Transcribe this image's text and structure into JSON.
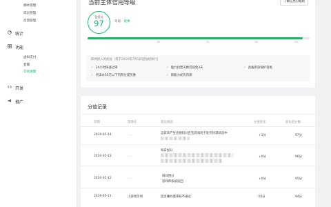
{
  "sidebar": {
    "sub_items_top": [
      "脚本管理",
      "成员管理",
      "反馈管理"
    ],
    "sections": [
      {
        "label": "统计",
        "icon": "chart-icon"
      },
      {
        "label": "功能",
        "icon": "grid-icon"
      }
    ],
    "feature_items": [
      "虚拟支付",
      "客服",
      "交易保障"
    ],
    "sections_bottom": [
      {
        "label": "开发",
        "icon": "code-icon"
      },
      {
        "label": "推广",
        "icon": "megaphone-icon"
      }
    ]
  },
  "credit_card": {
    "title": "当前主体信用等级",
    "rule_button": "了解信用分规则",
    "score_label": "信用分",
    "score": "97",
    "level_prefix": "等级 · ",
    "level": "优秀",
    "score_fraction": 0.97,
    "ticks": [
      "60",
      "70",
      "80",
      "90"
    ],
    "benefits_title": "即将接入的权益（将于2019年7月1日后陆续执行）",
    "benefits": [
      "24小时快速过审",
      "能力封禁天数可减免3天",
      "具备新游保护资格",
      "月流水50万以下内购分成优惠",
      "新能力优先内测"
    ],
    "colors": {
      "accent": "#07c160"
    }
  },
  "records": {
    "title": "分值记录",
    "headers": [
      "日期",
      "游戏名",
      "变化原因",
      "分值变化",
      "变化后分数"
    ],
    "rows": [
      {
        "date": "2019-05-14",
        "game": "...",
        "reason_lines": [
          "当日未产生违规扣分且无游戏处于处罚封禁状态中"
        ],
        "change": "+1分",
        "after": "97分"
      },
      {
        "date": "2019-05-13",
        "game": "...",
        "reason_lines": [
          "每日加分"
        ],
        "change": "+0分",
        "after": "96分"
      },
      {
        "date": "2019-05-12",
        "game": "...",
        "reason_lines": [
          "每日回分",
          "游戏审核被驳回"
        ],
        "change": "+0分",
        "after": "95分"
      },
      {
        "date": "2019-05-11",
        "game": "小游戏示例",
        "reason_lines": [
          "因涉嫌抄袭审核不通过"
        ],
        "change": "-10分",
        "after": "94分"
      }
    ]
  }
}
